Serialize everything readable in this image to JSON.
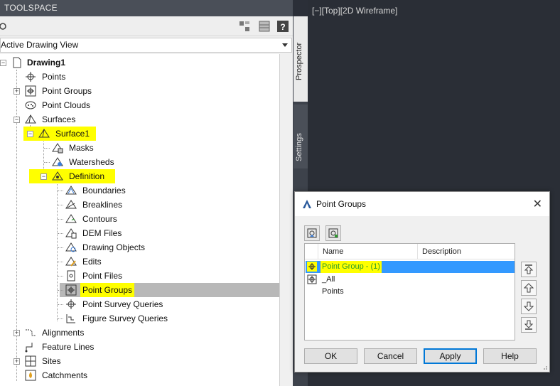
{
  "toolspace": {
    "title": "TOOLSPACE",
    "view_select": "Active Drawing View"
  },
  "tree": {
    "root": "Drawing1",
    "items": [
      {
        "label": "Points"
      },
      {
        "label": "Point Groups"
      },
      {
        "label": "Point Clouds"
      },
      {
        "label": "Surfaces"
      },
      {
        "label": "Surface1"
      },
      {
        "label": "Masks"
      },
      {
        "label": "Watersheds"
      },
      {
        "label": "Definition"
      },
      {
        "label": "Boundaries"
      },
      {
        "label": "Breaklines"
      },
      {
        "label": "Contours"
      },
      {
        "label": "DEM Files"
      },
      {
        "label": "Drawing Objects"
      },
      {
        "label": "Edits"
      },
      {
        "label": "Point Files"
      },
      {
        "label": "Point Groups"
      },
      {
        "label": "Point Survey Queries"
      },
      {
        "label": "Figure Survey Queries"
      },
      {
        "label": "Alignments"
      },
      {
        "label": "Feature Lines"
      },
      {
        "label": "Sites"
      },
      {
        "label": "Catchments"
      }
    ]
  },
  "side_tabs": {
    "prospector": "Prospector",
    "settings": "Settings"
  },
  "viewport": {
    "label": "[−][Top][2D Wireframe]"
  },
  "dialog": {
    "title": "Point Groups",
    "columns": {
      "name": "Name",
      "description": "Description"
    },
    "rows": [
      {
        "name": "Point Group - (1)",
        "selected": true
      },
      {
        "name": "_All Points",
        "selected": false
      }
    ],
    "buttons": {
      "ok": "OK",
      "cancel": "Cancel",
      "apply": "Apply",
      "help": "Help"
    }
  },
  "colors": {
    "highlight": "#ffff00",
    "selection": "#3399ff",
    "title_bar": "#4a4f58",
    "viewport_bg": "#2a2e36"
  }
}
